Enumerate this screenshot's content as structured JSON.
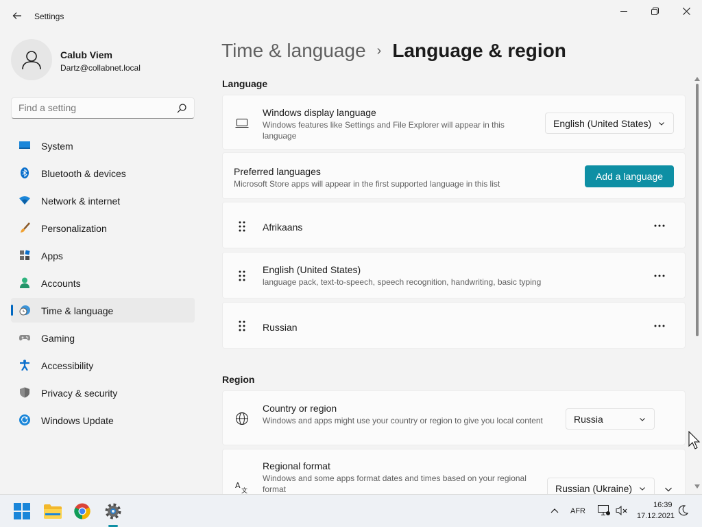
{
  "window": {
    "app_title": "Settings",
    "controls": {
      "minimize": "minimize",
      "maximize": "restore",
      "close": "close"
    }
  },
  "profile": {
    "name": "Calub Viem",
    "email": "Dartz@collabnet.local"
  },
  "search": {
    "placeholder": "Find a setting"
  },
  "nav": {
    "items": [
      {
        "label": "System",
        "icon": "monitor-icon",
        "color": "#0078d4"
      },
      {
        "label": "Bluetooth & devices",
        "icon": "bluetooth-icon",
        "color": "#0078d4"
      },
      {
        "label": "Network & internet",
        "icon": "wifi-icon",
        "color": "#0078d4"
      },
      {
        "label": "Personalization",
        "icon": "brush-icon",
        "color": "#e8912d"
      },
      {
        "label": "Apps",
        "icon": "apps-icon",
        "color": "#6b6b6b"
      },
      {
        "label": "Accounts",
        "icon": "person-icon",
        "color": "#2eb37e"
      },
      {
        "label": "Time & language",
        "icon": "clock-globe-icon",
        "color": "#0078d4",
        "active": true
      },
      {
        "label": "Gaming",
        "icon": "gamepad-icon",
        "color": "#7a7a7a"
      },
      {
        "label": "Accessibility",
        "icon": "accessibility-icon",
        "color": "#0078d4"
      },
      {
        "label": "Privacy & security",
        "icon": "shield-icon",
        "color": "#7a7a7a"
      },
      {
        "label": "Windows Update",
        "icon": "update-icon",
        "color": "#0078d4"
      }
    ]
  },
  "breadcrumb": {
    "parent": "Time & language",
    "separator": "›",
    "current": "Language & region"
  },
  "language_section": {
    "title": "Language",
    "display_language": {
      "title": "Windows display language",
      "desc": "Windows features like Settings and File Explorer will appear in this language",
      "value": "English (United States)"
    },
    "preferred": {
      "title": "Preferred languages",
      "desc": "Microsoft Store apps will appear in the first supported language in this list",
      "button": "Add a language"
    },
    "languages": [
      {
        "name": "Afrikaans",
        "features": ""
      },
      {
        "name": "English (United States)",
        "features": "language pack, text-to-speech, speech recognition, handwriting, basic typing"
      },
      {
        "name": "Russian",
        "features": ""
      }
    ]
  },
  "region_section": {
    "title": "Region",
    "country": {
      "title": "Country or region",
      "desc": "Windows and apps might use your country or region to give you local content",
      "value": "Russia"
    },
    "format": {
      "title": "Regional format",
      "desc": "Windows and some apps format dates and times based on your regional format",
      "value": "Russian (Ukraine)"
    }
  },
  "taskbar": {
    "apps": [
      "windows-start-icon",
      "file-explorer-icon",
      "chrome-icon",
      "settings-gear-icon"
    ],
    "lang": "AFR",
    "time": "16:39",
    "date": "17.12.2021"
  },
  "colors": {
    "accent": "#0e8fa4",
    "nav_active_bar": "#0067c0"
  }
}
